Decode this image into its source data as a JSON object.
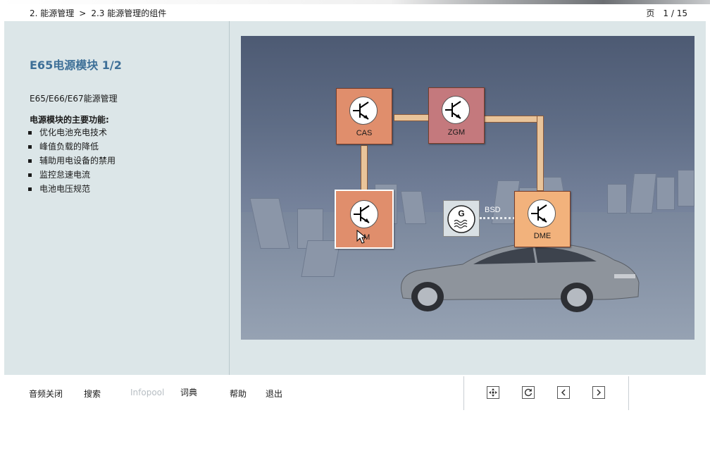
{
  "header": {
    "breadcrumb": [
      "2. 能源管理",
      "2.3 能源管理的组件"
    ],
    "breadcrumb_separator": ">",
    "page_label": "页",
    "page_number": "1 / 15"
  },
  "content": {
    "title": "E65电源模块 1/2",
    "subtitle": "E65/E66/E67能源管理",
    "features_heading": "电源模块的主要功能:",
    "features": [
      "优化电池充电技术",
      "峰值负载的降低",
      "辅助用电设备的禁用",
      "监控怠速电流",
      "电池电压规范"
    ]
  },
  "diagram": {
    "modules": [
      {
        "id": "cas",
        "label": "CAS",
        "color": "#e08e6c"
      },
      {
        "id": "zgm",
        "label": "ZGM",
        "color": "#c4797d"
      },
      {
        "id": "psm",
        "label": "PM",
        "color": "#e08e6c"
      },
      {
        "id": "dme",
        "label": "DME",
        "color": "#f2b27c"
      }
    ],
    "generator_symbol": "G",
    "bus_label": "BSD"
  },
  "footer": {
    "buttons": [
      "音频关闭",
      "搜索",
      "Infopool",
      "词典",
      "帮助",
      "退出"
    ],
    "disabled": [
      "Infopool"
    ],
    "nav_icons": [
      "overview-icon",
      "reload-icon",
      "previous-icon",
      "next-icon"
    ]
  }
}
